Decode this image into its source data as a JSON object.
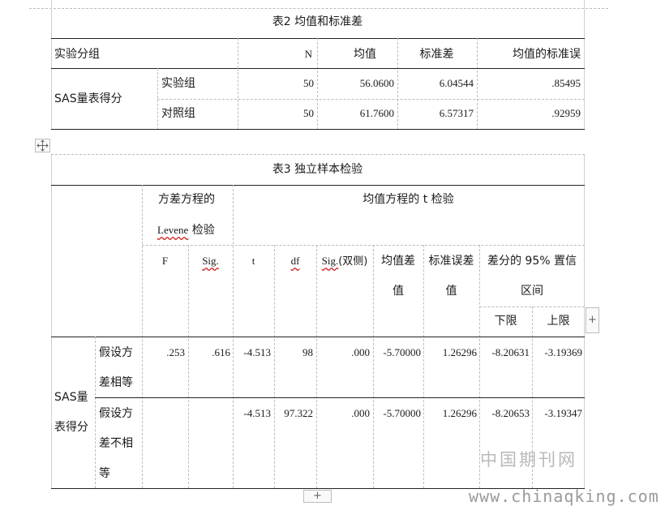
{
  "table2": {
    "caption": "表2  均值和标准差",
    "headers": {
      "group": "实验分组",
      "n": "N",
      "mean": "均值",
      "sd": "标准差",
      "se": "均值的标准误"
    },
    "row_label": "SAS量表得分",
    "rows": [
      {
        "label": "实验组",
        "n": "50",
        "mean": "56.0600",
        "sd": "6.04544",
        "se": ".85495"
      },
      {
        "label": "对照组",
        "n": "50",
        "mean": "61.7600",
        "sd": "6.57317",
        "se": ".92959"
      }
    ]
  },
  "table3": {
    "caption": "表3  独立样本检验",
    "levene_header_1": "方差方程的",
    "levene_header_2_word": "Levene",
    "levene_header_2_rest": " 检验",
    "ttest_header": "均值方程的 t 检验",
    "sub": {
      "f": "F",
      "sig": "Sig.",
      "t": "t",
      "df": "df",
      "sig2_word": "Sig.",
      "sig2_rest": "(双侧)",
      "mean_diff_1": "均值差",
      "mean_diff_2": "值",
      "se_diff_1": "标准误差",
      "se_diff_2": "值",
      "ci_1": "差分的 95% 置信",
      "ci_2": "区间",
      "lower": "下限",
      "upper": "上限"
    },
    "row_label_1": "SAS量",
    "row_label_2": "表得分",
    "rows": [
      {
        "label_lines": [
          "假设方",
          "差相等"
        ],
        "f": ".253",
        "sig": ".616",
        "t": "-4.513",
        "df": "98",
        "sig2": ".000",
        "mean_diff": "-5.70000",
        "se_diff": "1.26296",
        "lower": "-8.20631",
        "upper": "-3.19369"
      },
      {
        "label_lines": [
          "假设方",
          "差不相",
          "等"
        ],
        "f": "",
        "sig": "",
        "t": "-4.513",
        "df": "97.322",
        "sig2": ".000",
        "mean_diff": "-5.70000",
        "se_diff": "1.26296",
        "lower": "-8.20653",
        "upper": "-3.19347"
      }
    ]
  },
  "editor": {
    "move_handle_icon": "move-icon",
    "add_column_label": "+",
    "add_row_label": "+"
  },
  "watermark": {
    "cn": "中国期刊网",
    "url": "www.chinaqking.com"
  }
}
